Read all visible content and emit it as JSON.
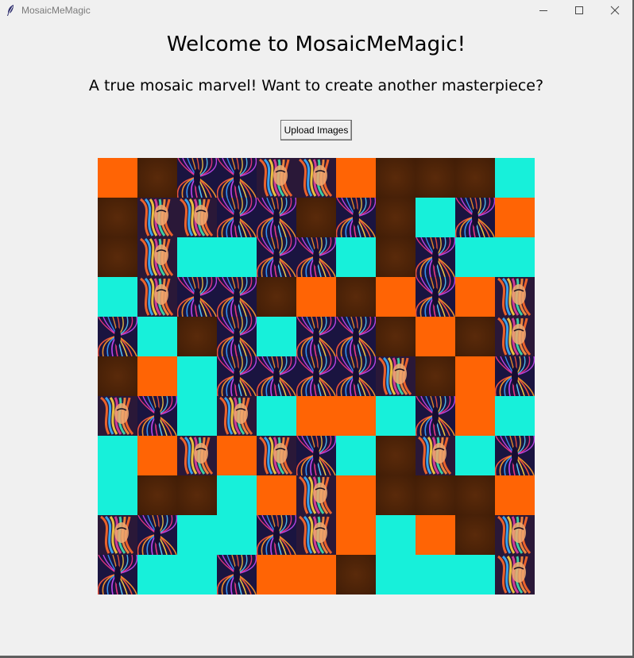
{
  "window": {
    "title": "MosaicMeMagic",
    "icon": "feather-icon",
    "controls": [
      "minimize-icon",
      "maximize-icon",
      "close-icon"
    ]
  },
  "main": {
    "heading": "Welcome to MosaicMeMagic!",
    "subheading": "A true mosaic marvel! Want to create another masterpiece?",
    "upload_button_label": "Upload Images"
  },
  "mosaic": {
    "rows": 11,
    "columns": 11,
    "tile_kinds": {
      "O": "solid orange tile",
      "B": "dark brown tile",
      "C": "solid cyan tile",
      "S": "light-streak image tile",
      "F": "abstract face image tile"
    },
    "colors": {
      "O": "#ff6405",
      "B": "#3f1c06",
      "C": "#17f0da",
      "S_bg": "#1a1440",
      "F_bg": "#2a1838"
    },
    "grid": [
      "OBSSFFOBBBC",
      "BFFSSBSBCSO",
      "BFCCSSCBSCC",
      "CFSSBOBOSOF",
      "SCBSCSSBOBF",
      "BOCSSSSFBOS",
      "FSCFCOOCSOC",
      "COFOFSCBFCS",
      "CBBCOFOBBBO",
      "FSCCSFOCOBF",
      "SCCSOOBCCCF"
    ]
  }
}
